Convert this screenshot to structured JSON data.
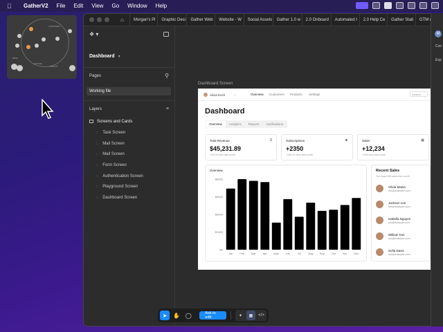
{
  "menubar": {
    "app": "GatherV2",
    "items": [
      "File",
      "Edit",
      "View",
      "Go",
      "Window",
      "Help"
    ]
  },
  "minimap": {
    "labels": [
      "CAFETERIA",
      "LOUNGE",
      "PANTRY",
      "DESK"
    ]
  },
  "tabs": [
    "Morgan's Pl",
    "Graphic Desi",
    "Gather Web",
    "Website - W",
    "Social Assets",
    "Gather 1.0 w",
    "2.0 Onboard",
    "Automated I",
    "2.0 Help Ce",
    "Gather Stati",
    "GTM mocks"
  ],
  "sidebar": {
    "title": "Dashboard",
    "pages_label": "Pages",
    "working_file": "Working file",
    "layers_label": "Layers",
    "group": "Screens and Cards",
    "items": [
      "Task Screen",
      "Mail Screen",
      "Mail Screen",
      "Form Screen",
      "Authentication Screen",
      "Playground Screen",
      "Dashboard Screen"
    ]
  },
  "canvas": {
    "frame_label": "Dashboard Screen"
  },
  "dashboard": {
    "user": "Alicia Koch",
    "nav": [
      "Overview",
      "Customers",
      "Products",
      "Settings"
    ],
    "search": "Search...",
    "title": "Dashboard",
    "tabs": [
      "Overview",
      "Analytics",
      "Reports",
      "Notifications"
    ],
    "stats": [
      {
        "label": "Total Revenue",
        "icon": "$",
        "value": "$45,231.89",
        "sub": "+20.1% from last month"
      },
      {
        "label": "Subscriptions",
        "icon": "users",
        "value": "+2350",
        "sub": "+180.1% from last month"
      },
      {
        "label": "Sales",
        "icon": "card",
        "value": "+12,234",
        "sub": "+19% from last month"
      }
    ],
    "overview_label": "Overview",
    "recent": {
      "title": "Recent Sales",
      "sub": "You made 265 sales this month.",
      "people": [
        {
          "name": "Olivia Martin",
          "email": "me@example.com"
        },
        {
          "name": "Jackson Lee",
          "email": "me@example.com"
        },
        {
          "name": "Isabella Nguyen",
          "email": "me@example.com"
        },
        {
          "name": "William Kim",
          "email": "me@example.com"
        },
        {
          "name": "Sofia Davis",
          "email": "me@example.com"
        }
      ]
    }
  },
  "chart_data": {
    "type": "bar",
    "categories": [
      "Jan",
      "Feb",
      "Mar",
      "Apr",
      "May",
      "Jun",
      "Jul",
      "Aug",
      "Sep",
      "Oct",
      "Nov",
      "Dec"
    ],
    "values": [
      5200,
      6000,
      5850,
      5750,
      2300,
      4300,
      2800,
      4000,
      3300,
      3400,
      3800,
      4400
    ],
    "yticks": [
      "$6000",
      "$4500",
      "$3000",
      "$1500",
      "$0"
    ],
    "ylim": [
      0,
      6000
    ]
  },
  "toolbar": {
    "ask_label": "Ask to edit"
  },
  "right_panel": {
    "avatar": "M",
    "t1": "Con",
    "t2": "Exp"
  }
}
